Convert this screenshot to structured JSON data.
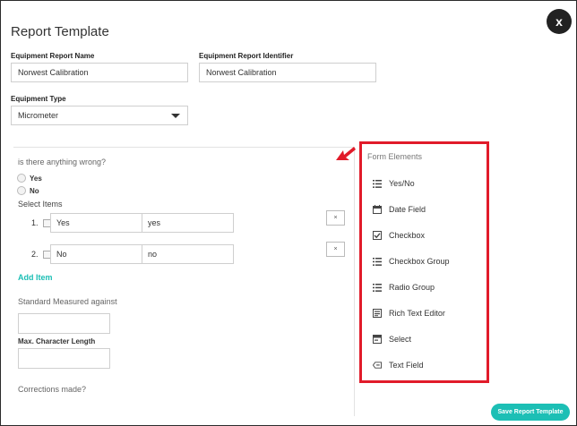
{
  "dialog": {
    "title": "Report Template",
    "close_glyph": "x",
    "save_label": "Save Report Template"
  },
  "fields": {
    "report_name_label": "Equipment Report Name",
    "report_name_value": "Norwest Calibration",
    "identifier_label": "Equipment Report Identifier",
    "identifier_value": "Norwest Calibration",
    "type_label": "Equipment Type",
    "type_value": "Micrometer"
  },
  "editor": {
    "question1": "is there anything wrong?",
    "radio_yes": "Yes",
    "radio_no": "No",
    "select_items_label": "Select Items",
    "items": [
      {
        "num": "1.",
        "label": "Yes",
        "value": "yes",
        "remove": "×"
      },
      {
        "num": "2.",
        "label": "No",
        "value": "no",
        "remove": "×"
      }
    ],
    "add_item": "Add Item",
    "question2": "Standard Measured against",
    "max_len_label": "Max. Character Length",
    "question3": "Corrections made?"
  },
  "form_elements": {
    "title": "Form Elements",
    "items": [
      {
        "label": "Yes/No",
        "icon": "list-icon"
      },
      {
        "label": "Date Field",
        "icon": "calendar-icon"
      },
      {
        "label": "Checkbox",
        "icon": "checkbox-icon"
      },
      {
        "label": "Checkbox Group",
        "icon": "list-icon"
      },
      {
        "label": "Radio Group",
        "icon": "list-icon"
      },
      {
        "label": "Rich Text Editor",
        "icon": "text-editor-icon"
      },
      {
        "label": "Select",
        "icon": "select-icon"
      },
      {
        "label": "Text Field",
        "icon": "text-field-icon"
      }
    ]
  },
  "colors": {
    "accent": "#1cbfb5",
    "highlight": "#e11b2a",
    "close_bg": "#222222"
  }
}
